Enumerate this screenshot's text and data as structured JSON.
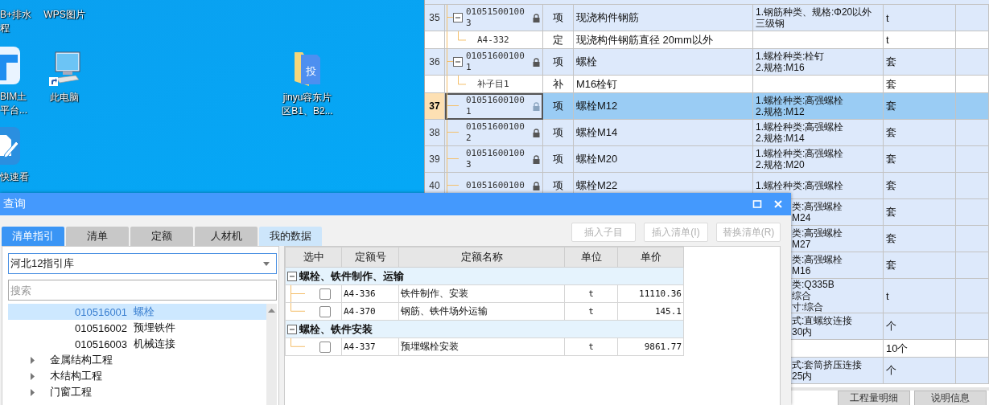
{
  "desktop": {
    "icons": [
      {
        "kind": "none",
        "label": [
          "B+排水",
          "程"
        ]
      },
      {
        "kind": "none",
        "label": [
          "WPS图片"
        ]
      },
      {
        "kind": "app-t",
        "label": [
          "BIM土",
          "平台..."
        ]
      },
      {
        "kind": "computer",
        "label": [
          "此电脑"
        ]
      },
      {
        "kind": "app-pen",
        "label": [
          "快速看"
        ]
      },
      {
        "kind": "folder",
        "glyph": "投",
        "label": [
          "jinyu容东片",
          "区B1、B2..."
        ]
      }
    ]
  },
  "sheet": {
    "rows": [
      {
        "kind": "item",
        "num": "35",
        "code": "010515001003",
        "expanded": true,
        "locked": true,
        "type": "项",
        "name": "现浇构件钢筋",
        "features": [
          "1.钢筋种类、规格:Φ20以外",
          "三级钢"
        ],
        "unit": "t",
        "selected": false
      },
      {
        "kind": "child",
        "code": "A4-332",
        "type": "定",
        "name": "现浇构件钢筋直径 20mm以外",
        "features": [],
        "unit": "t",
        "selected": false
      },
      {
        "kind": "item",
        "num": "36",
        "code": "010516001001",
        "expanded": true,
        "locked": true,
        "type": "项",
        "name": "螺栓",
        "features": [
          "1.螺栓种类:栓钉",
          "2.规格:M16"
        ],
        "unit": "套",
        "selected": false
      },
      {
        "kind": "child",
        "code": "补子目1",
        "type": "补",
        "name": "M16栓钉",
        "features": [],
        "unit": "套",
        "selected": false
      },
      {
        "kind": "item",
        "num": "37",
        "code": "010516001001",
        "locked": true,
        "type": "项",
        "name": "螺栓M12",
        "features": [
          "1.螺栓种类:高强螺栓",
          "2.规格:M12"
        ],
        "unit": "套",
        "selected": true
      },
      {
        "kind": "item",
        "num": "38",
        "code": "010516001002",
        "locked": true,
        "type": "项",
        "name": "螺栓M14",
        "features": [
          "1.螺栓种类:高强螺栓",
          "2.规格:M14"
        ],
        "unit": "套",
        "selected": false
      },
      {
        "kind": "item",
        "num": "39",
        "code": "010516001003",
        "locked": true,
        "type": "项",
        "name": "螺栓M20",
        "features": [
          "1.螺栓种类:高强螺栓",
          "2.规格:M20"
        ],
        "unit": "套",
        "selected": false
      },
      {
        "kind": "item",
        "num": "40",
        "code": "01051600100",
        "locked": true,
        "type": "项",
        "name": "螺栓M22",
        "features": [
          "1.螺栓种类:高强螺栓"
        ],
        "unit": "套",
        "selected": false
      },
      {
        "kind": "covered",
        "features": [
          "类:高强螺栓",
          "M24"
        ],
        "unit": "套",
        "selected": false
      },
      {
        "kind": "covered",
        "features": [
          "类:高强螺栓",
          "M27"
        ],
        "unit": "套",
        "selected": false
      },
      {
        "kind": "covered",
        "features": [
          "类:高强螺栓",
          "M16"
        ],
        "unit": "套",
        "selected": false
      },
      {
        "kind": "covered",
        "features": [
          "类:Q335B",
          "综合",
          "寸:综合"
        ],
        "unit": "t",
        "selected": false
      },
      {
        "kind": "covered",
        "features": [
          "式:直螺纹连接",
          "30内"
        ],
        "unit": "个",
        "selected": false
      },
      {
        "kind": "covered-child",
        "features": [],
        "unit": "10个",
        "selected": false
      },
      {
        "kind": "covered",
        "features": [
          "式:套筒挤压连接",
          "25内"
        ],
        "unit": "个",
        "selected": false
      }
    ],
    "bottom_tabs": [
      {
        "label": "工程量明细",
        "selected": false
      },
      {
        "label": "说明信息",
        "selected": false
      }
    ]
  },
  "dialog": {
    "title": "查询",
    "tabs": [
      {
        "label": "清单指引",
        "selected": true,
        "hovered": false
      },
      {
        "label": "清单",
        "selected": false,
        "hovered": false
      },
      {
        "label": "定额",
        "selected": false,
        "hovered": false
      },
      {
        "label": "人材机",
        "selected": false,
        "hovered": false
      },
      {
        "label": "我的数据",
        "selected": false,
        "hovered": true
      }
    ],
    "buttons": [
      {
        "label": "插入子目",
        "disabled": true
      },
      {
        "label": "插入清单(I)",
        "disabled": true
      },
      {
        "label": "替换清单(R)",
        "disabled": true
      }
    ],
    "library": {
      "value": "河北12指引库"
    },
    "search": {
      "placeholder": "搜索"
    },
    "tree": [
      {
        "kind": "leaf",
        "code": "010516001",
        "label": "螺栓",
        "selected": true
      },
      {
        "kind": "leaf",
        "code": "010516002",
        "label": "预埋铁件",
        "selected": false
      },
      {
        "kind": "leaf",
        "code": "010516003",
        "label": "机械连接",
        "selected": false
      },
      {
        "kind": "group",
        "label": "金属结构工程",
        "expanded": false,
        "selected": false
      },
      {
        "kind": "group",
        "label": "木结构工程",
        "expanded": false,
        "selected": false
      },
      {
        "kind": "group",
        "label": "门窗工程",
        "expanded": false,
        "selected": false
      }
    ],
    "table": {
      "columns": [
        "选中",
        "定额号",
        "定额名称",
        "单位",
        "单价"
      ],
      "groups": [
        {
          "name": "螺栓、铁件制作、运输",
          "expanded": true,
          "rows": [
            {
              "checked": false,
              "code": "A4-336",
              "name": "铁件制作、安装",
              "unit": "t",
              "price": "11110.36"
            },
            {
              "checked": false,
              "code": "A4-370",
              "name": "钢筋、铁件场外运输",
              "unit": "t",
              "price": "145.1"
            }
          ]
        },
        {
          "name": "螺栓、铁件安装",
          "expanded": true,
          "rows": [
            {
              "checked": false,
              "code": "A4-337",
              "name": "预埋螺栓安装",
              "unit": "t",
              "price": "9861.77"
            }
          ]
        }
      ]
    }
  }
}
